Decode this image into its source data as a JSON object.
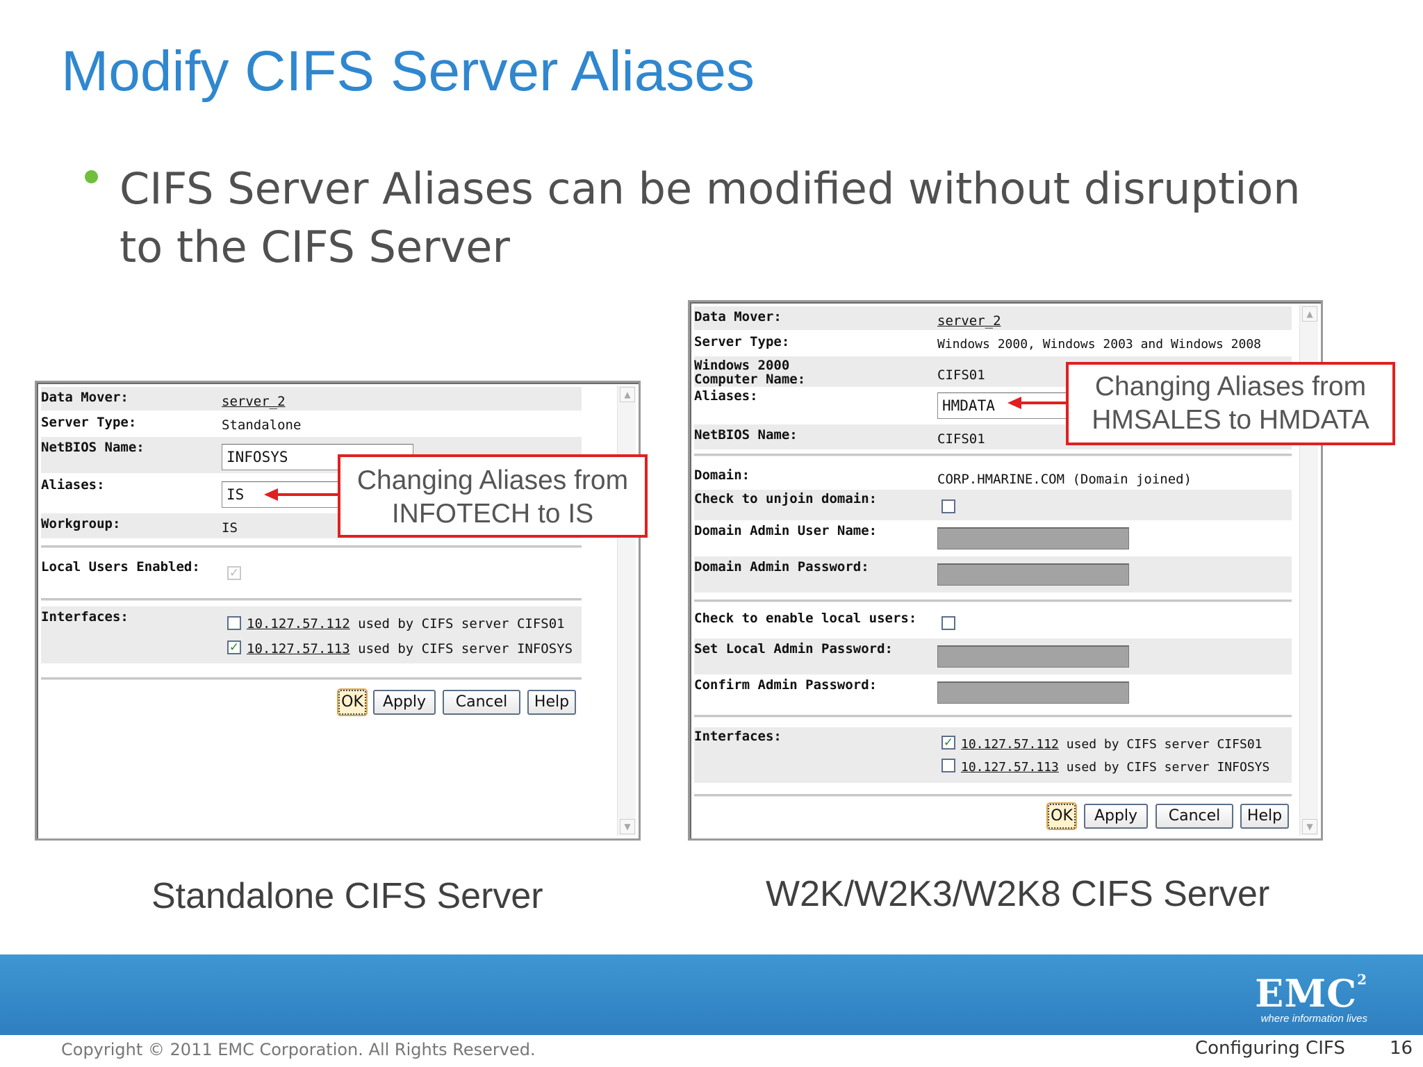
{
  "slide": {
    "title": "Modify CIFS Server Aliases",
    "bullet": "CIFS Server Aliases can be modified without disruption to the CIFS Server"
  },
  "left_panel": {
    "data_mover_label": "Data Mover:",
    "data_mover_value": "server_2",
    "server_type_label": "Server Type:",
    "server_type_value": "Standalone",
    "netbios_label": "NetBIOS Name:",
    "netbios_value": "INFOSYS",
    "aliases_label": "Aliases:",
    "aliases_value": "IS",
    "workgroup_label": "Workgroup:",
    "workgroup_value": "IS",
    "local_users_label": "Local Users Enabled:",
    "local_users_checked": true,
    "interfaces_label": "Interfaces:",
    "interfaces": [
      {
        "ip": "10.127.57.112",
        "text": "used by CIFS server CIFS01",
        "checked": false
      },
      {
        "ip": "10.127.57.113",
        "text": "used by CIFS server INFOSYS",
        "checked": true
      }
    ],
    "buttons": {
      "ok": "OK",
      "apply": "Apply",
      "cancel": "Cancel",
      "help": "Help"
    },
    "callout_line1": "Changing Aliases from",
    "callout_line2": "INFOTECH to IS"
  },
  "right_panel": {
    "data_mover_label": "Data Mover:",
    "data_mover_value": "server_2",
    "server_type_label": "Server Type:",
    "server_type_value": "Windows 2000, Windows 2003 and Windows 2008",
    "computer_name_label_1": "Windows 2000",
    "computer_name_label_2": "Computer Name:",
    "computer_name_value": "CIFS01",
    "aliases_label": "Aliases:",
    "aliases_value": "HMDATA",
    "netbios_label": "NetBIOS Name:",
    "netbios_value": "CIFS01",
    "domain_label": "Domain:",
    "domain_value": "CORP.HMARINE.COM (Domain joined)",
    "unjoin_label": "Check to unjoin domain:",
    "admin_user_label": "Domain Admin User Name:",
    "admin_password_label": "Domain Admin Password:",
    "enable_local_label": "Check to enable local users:",
    "set_local_pw_label": "Set Local Admin Password:",
    "confirm_pw_label": "Confirm Admin Password:",
    "interfaces_label": "Interfaces:",
    "interfaces": [
      {
        "ip": "10.127.57.112",
        "text": "used by CIFS server CIFS01",
        "checked": true
      },
      {
        "ip": "10.127.57.113",
        "text": "used by CIFS server INFOSYS",
        "checked": false
      }
    ],
    "buttons": {
      "ok": "OK",
      "apply": "Apply",
      "cancel": "Cancel",
      "help": "Help"
    },
    "callout_line1": "Changing Aliases from",
    "callout_line2": "HMSALES to HMDATA"
  },
  "captions": {
    "left": "Standalone CIFS Server",
    "right": "W2K/W2K3/W2K8 CIFS Server"
  },
  "footer": {
    "copyright": "Copyright © 2011 EMC Corporation. All Rights Reserved.",
    "section": "Configuring CIFS",
    "page": "16",
    "logo_text": "EMC",
    "logo_sup": "2",
    "logo_tagline": "where information lives"
  },
  "colors": {
    "title": "#2f87cf",
    "bullet": "#6fbf3c",
    "callout_border": "#e02020",
    "footer_band": "#3a8fcf"
  }
}
